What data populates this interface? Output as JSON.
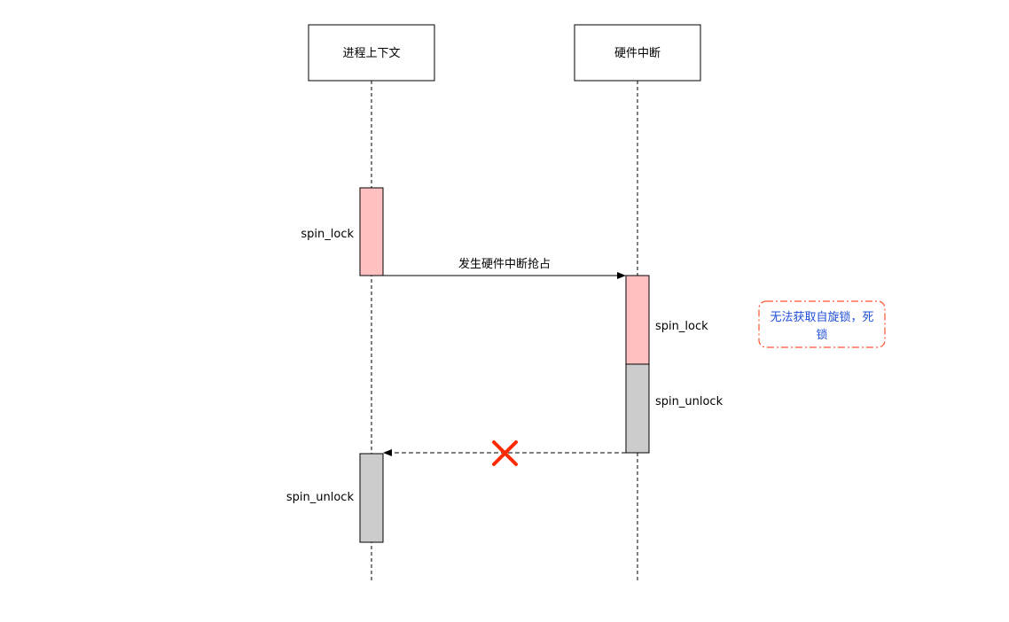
{
  "participants": {
    "process": {
      "label": "进程上下文"
    },
    "irq": {
      "label": "硬件中断"
    }
  },
  "activations": {
    "process_lock_label": "spin_lock",
    "irq_lock_label": "spin_lock",
    "irq_unlock_label": "spin_unlock",
    "process_unlock_label": "spin_unlock"
  },
  "messages": {
    "preempt_label": "发生硬件中断抢占"
  },
  "note": {
    "line1": "无法获取自旋锁，死",
    "line2": "锁"
  },
  "colors": {
    "lock_fill": "#FFC0C0",
    "unlock_fill": "#CCCCCC",
    "cross": "#FF2A00",
    "note_border": "#FF5533",
    "note_text": "#1F4FD9",
    "stroke": "#000000"
  }
}
